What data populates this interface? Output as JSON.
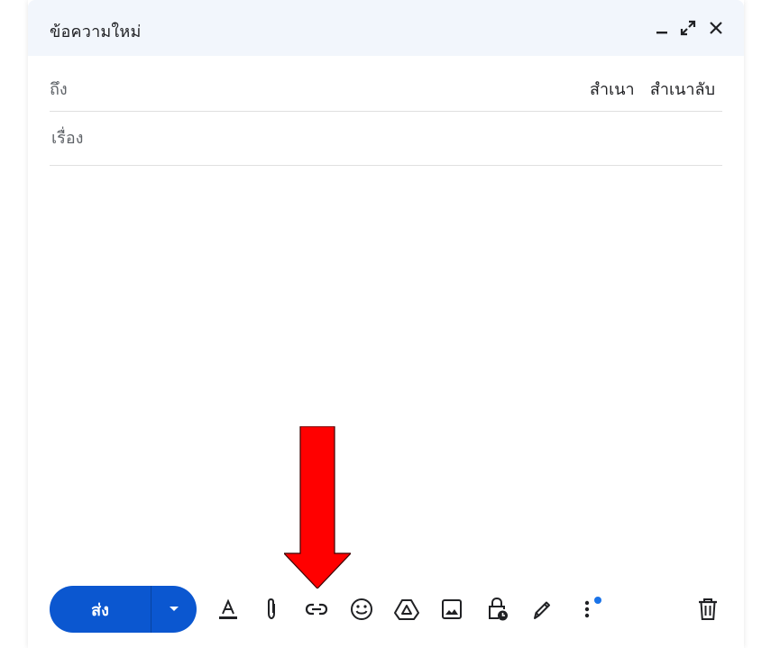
{
  "compose": {
    "title": "ข้อความใหม่",
    "to_label": "ถึง",
    "to_value": "",
    "cc_label": "สำเนา",
    "bcc_label": "สำเนาลับ",
    "subject_placeholder": "เรื่อง",
    "body_text": ""
  },
  "toolbar": {
    "send_label": "ส่ง"
  },
  "colors": {
    "send": "#0b57d0",
    "header_bg": "#f2f6fc",
    "arrow": "#ff0000",
    "badge": "#1a73e8"
  },
  "icons": [
    "minimize-icon",
    "expand-icon",
    "close-icon",
    "chevron-down-icon",
    "text-format-icon",
    "attach-icon",
    "link-icon",
    "emoji-icon",
    "drive-icon",
    "image-icon",
    "confidential-lock-icon",
    "signature-pen-icon",
    "more-options-icon",
    "trash-icon"
  ]
}
